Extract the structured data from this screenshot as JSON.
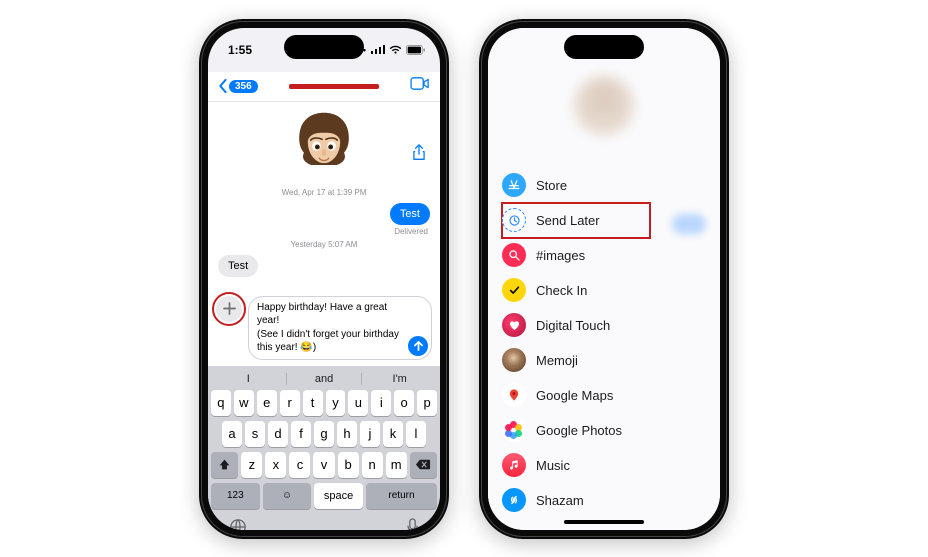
{
  "left": {
    "status": {
      "time": "1:55"
    },
    "nav": {
      "back_count": "356",
      "title_redacted": true
    },
    "chat": {
      "date1": "Wed, Apr 17 at 1:39 PM",
      "out1": "Test",
      "delivered": "Delivered",
      "date2": "Yesterday 5:07 AM",
      "in1": "Test"
    },
    "compose": {
      "line1": "Happy birthday! Have a great year!",
      "line2_prefix": "(See I didn't forget your birthday this year! ",
      "line2_emoji": "😂",
      "line2_suffix": ")"
    },
    "keyboard": {
      "pred": [
        "I",
        "and",
        "I'm"
      ],
      "row1": [
        "q",
        "w",
        "e",
        "r",
        "t",
        "y",
        "u",
        "i",
        "o",
        "p"
      ],
      "row2": [
        "a",
        "s",
        "d",
        "f",
        "g",
        "h",
        "j",
        "k",
        "l"
      ],
      "row3_letters": [
        "z",
        "x",
        "c",
        "v",
        "b",
        "n",
        "m"
      ],
      "key_123": "123",
      "key_space": "space",
      "key_return": "return"
    }
  },
  "right": {
    "menu": [
      {
        "id": "store",
        "label": "Store",
        "icon": "store-icon",
        "hl": false
      },
      {
        "id": "send-later",
        "label": "Send Later",
        "icon": "clock-icon",
        "hl": true
      },
      {
        "id": "images",
        "label": "#images",
        "icon": "search-icon",
        "hl": false
      },
      {
        "id": "check-in",
        "label": "Check In",
        "icon": "checkmark-icon",
        "hl": false
      },
      {
        "id": "digital-touch",
        "label": "Digital Touch",
        "icon": "heart-icon",
        "hl": false
      },
      {
        "id": "memoji",
        "label": "Memoji",
        "icon": "memoji-icon",
        "hl": false
      },
      {
        "id": "google-maps",
        "label": "Google Maps",
        "icon": "maps-pin-icon",
        "hl": false
      },
      {
        "id": "google-photos",
        "label": "Google Photos",
        "icon": "photos-icon",
        "hl": false
      },
      {
        "id": "music",
        "label": "Music",
        "icon": "music-note-icon",
        "hl": false
      },
      {
        "id": "shazam",
        "label": "Shazam",
        "icon": "shazam-icon",
        "hl": false
      }
    ]
  }
}
